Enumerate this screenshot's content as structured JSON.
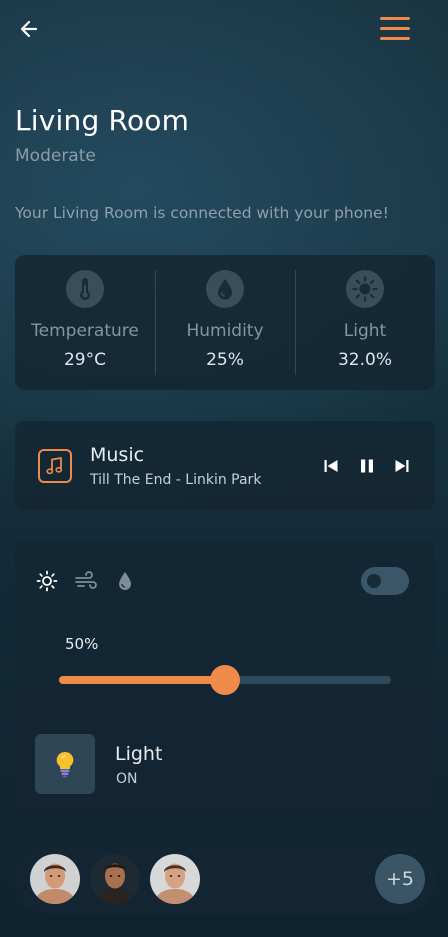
{
  "header": {
    "back_icon": "arrow-left-icon",
    "menu_icon": "hamburger-menu-icon"
  },
  "room": {
    "title": "Living Room",
    "subtitle": "Moderate",
    "connection_message": "Your Living Room is connected with your phone!"
  },
  "sensors": [
    {
      "icon": "thermometer-icon",
      "label": "Temperature",
      "value": "29°C"
    },
    {
      "icon": "water-drop-icon",
      "label": "Humidity",
      "value": "25%"
    },
    {
      "icon": "sun-icon",
      "label": "Light",
      "value": "32.0%"
    }
  ],
  "music": {
    "icon": "music-note-icon",
    "title": "Music",
    "song": "Till The End - Linkin Park",
    "controls": [
      "skip-previous-icon",
      "pause-icon",
      "skip-next-icon"
    ]
  },
  "control": {
    "modes": [
      "sun-icon",
      "wind-icon",
      "water-drop-icon"
    ],
    "active_mode": "sun-icon",
    "toggle_on": false,
    "level_label": "50%",
    "level": 0.5,
    "device_icon": "light-bulb-icon",
    "device_name": "Light",
    "device_state": "ON"
  },
  "members": {
    "avatars": [
      "avatar-1",
      "avatar-2",
      "avatar-3"
    ],
    "more_count": "+5"
  },
  "colors": {
    "accent": "#ee8a4a",
    "card": "#142632",
    "background": "#15303d"
  }
}
